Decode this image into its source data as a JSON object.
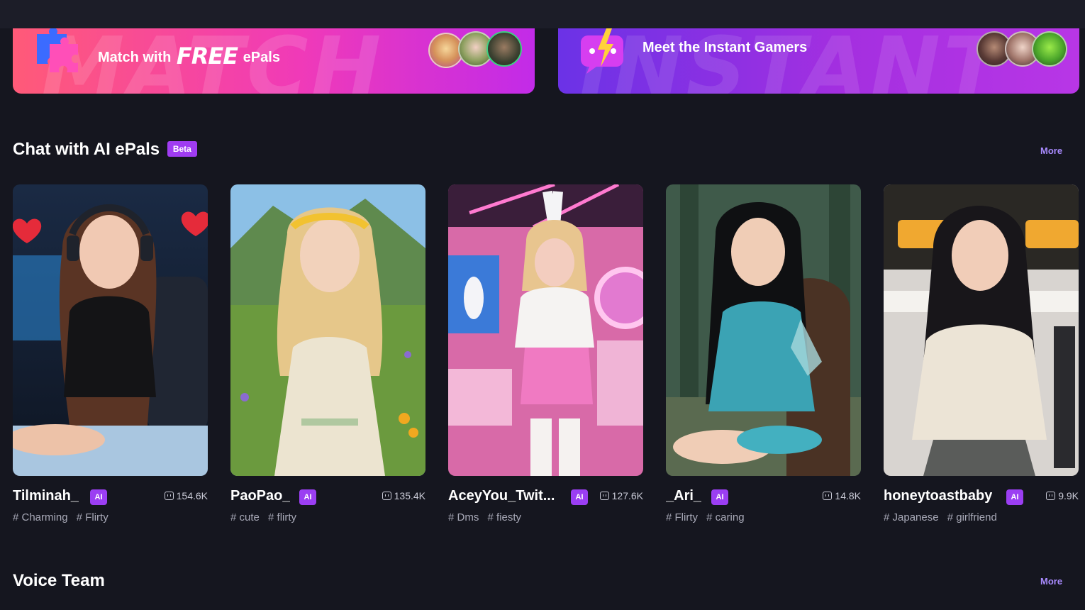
{
  "banners": {
    "match": {
      "prefix": "Match with",
      "free": "FREE",
      "suffix": "ePals",
      "watermark": "MATCH",
      "icon": "puzzle-icon"
    },
    "instant": {
      "title": "Meet the Instant Gamers",
      "watermark": "INSTANT",
      "icon": "lightning-chat-icon"
    }
  },
  "sections": {
    "ai": {
      "title": "Chat with AI ePals",
      "badge": "Beta",
      "more": "More"
    },
    "voice": {
      "title": "Voice Team",
      "more": "More"
    }
  },
  "cards": [
    {
      "name": "Tilminah_",
      "badge": "AI",
      "count": "154.6K",
      "tags": [
        "# Charming",
        "# Flirty"
      ]
    },
    {
      "name": "PaoPao_",
      "badge": "AI",
      "count": "135.4K",
      "tags": [
        "# cute",
        "# flirty"
      ]
    },
    {
      "name": "AceyYou_Twit...",
      "badge": "AI",
      "count": "127.6K",
      "tags": [
        "# Dms",
        "# fiesty"
      ]
    },
    {
      "name": "_Ari_",
      "badge": "AI",
      "count": "14.8K",
      "tags": [
        "# Flirty",
        "# caring"
      ]
    },
    {
      "name": "honeytoastbaby",
      "badge": "AI",
      "count": "9.9K",
      "tags": [
        "# Japanese",
        "# girlfriend"
      ]
    }
  ],
  "colors": {
    "background": "#15161f",
    "accent": "#9b3ef3",
    "more_link": "#a98bff"
  }
}
